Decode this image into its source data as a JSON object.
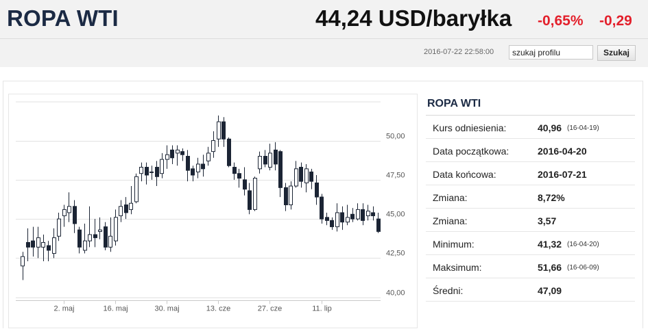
{
  "header": {
    "title": "ROPA WTI",
    "price": "44,24 USD/baryłka",
    "change_pct": "-0,65%",
    "change_abs": "-0,29",
    "timestamp": "2016-07-22 22:58:00",
    "search_value": "szukaj profilu",
    "search_button": "Szukaj"
  },
  "colors": {
    "negative": "#e3202c",
    "up_candle": "#ffffff",
    "down_candle": "#1b2434",
    "title": "#1b2a44"
  },
  "info": {
    "title": "ROPA WTI",
    "rows": [
      {
        "label": "Kurs odniesienia:",
        "value": "40,96",
        "date": "(16-04-19)"
      },
      {
        "label": "Data początkowa:",
        "value": "2016-04-20",
        "date": ""
      },
      {
        "label": "Data końcowa:",
        "value": "2016-07-21",
        "date": ""
      },
      {
        "label": "Zmiana:",
        "value": "8,72%",
        "date": ""
      },
      {
        "label": "Zmiana:",
        "value": "3,57",
        "date": ""
      },
      {
        "label": "Minimum:",
        "value": "41,32",
        "date": "(16-04-20)"
      },
      {
        "label": "Maksimum:",
        "value": "51,66",
        "date": "(16-06-09)"
      },
      {
        "label": "Średni:",
        "value": "47,09",
        "date": ""
      }
    ]
  },
  "chart_data": {
    "type": "candlestick",
    "y_ticks": [
      40,
      42.5,
      45,
      47.5,
      50
    ],
    "y_tick_labels": [
      "40,00",
      "42,50",
      "45,00",
      "47,50",
      "50,00"
    ],
    "ylim": [
      39.9,
      52.6
    ],
    "x_tick_index": [
      8,
      18,
      28,
      38,
      48,
      58
    ],
    "x_tick_labels": [
      "2. maj",
      "16. maj",
      "30. maj",
      "13. cze",
      "27. cze",
      "11. lip"
    ],
    "grid": true,
    "candles": [
      [
        42.0,
        42.6,
        41.1,
        42.9
      ],
      [
        43.5,
        43.2,
        42.3,
        44.4
      ],
      [
        43.6,
        43.2,
        42.6,
        44.5
      ],
      [
        43.2,
        43.8,
        42.5,
        44.5
      ],
      [
        43.2,
        43.5,
        42.3,
        44.0
      ],
      [
        43.3,
        43.0,
        42.3,
        43.6
      ],
      [
        42.8,
        43.8,
        42.5,
        44.4
      ],
      [
        43.9,
        45.0,
        43.6,
        45.4
      ],
      [
        45.2,
        45.6,
        44.5,
        45.9
      ],
      [
        45.4,
        45.8,
        44.8,
        46.7
      ],
      [
        45.8,
        44.7,
        44.1,
        46.2
      ],
      [
        44.3,
        43.2,
        42.8,
        44.5
      ],
      [
        43.0,
        43.6,
        42.8,
        44.7
      ],
      [
        43.6,
        44.0,
        43.2,
        45.8
      ],
      [
        44.0,
        43.8,
        43.2,
        45.0
      ],
      [
        44.2,
        44.3,
        43.7,
        45.1
      ],
      [
        44.5,
        43.2,
        43.0,
        44.8
      ],
      [
        43.2,
        43.9,
        42.9,
        45.1
      ],
      [
        43.6,
        45.1,
        43.3,
        45.6
      ],
      [
        45.2,
        45.8,
        44.8,
        46.2
      ],
      [
        45.9,
        45.4,
        45.0,
        46.4
      ],
      [
        45.6,
        46.0,
        45.3,
        47.1
      ],
      [
        46.1,
        47.7,
        46.0,
        47.9
      ],
      [
        47.9,
        48.3,
        47.4,
        48.6
      ],
      [
        48.3,
        47.8,
        47.2,
        48.6
      ],
      [
        48.0,
        48.0,
        47.5,
        48.4
      ],
      [
        48.3,
        47.7,
        47.1,
        48.7
      ],
      [
        47.9,
        48.8,
        47.6,
        49.2
      ],
      [
        48.8,
        49.1,
        48.2,
        49.7
      ],
      [
        49.4,
        48.9,
        48.5,
        49.7
      ],
      [
        49.2,
        49.4,
        48.4,
        49.7
      ],
      [
        49.3,
        49.1,
        48.7,
        49.5
      ],
      [
        49.0,
        48.1,
        47.4,
        49.4
      ],
      [
        48.2,
        47.8,
        47.4,
        48.4
      ],
      [
        48.0,
        48.5,
        47.6,
        48.9
      ],
      [
        48.5,
        48.2,
        47.7,
        49.1
      ],
      [
        48.7,
        49.2,
        48.4,
        49.6
      ],
      [
        49.3,
        50.0,
        48.9,
        50.6
      ],
      [
        50.1,
        51.2,
        49.6,
        51.6
      ],
      [
        51.2,
        50.1,
        49.6,
        51.5
      ],
      [
        50.1,
        48.4,
        48.3,
        50.2
      ],
      [
        48.3,
        47.9,
        47.5,
        48.6
      ],
      [
        47.9,
        47.6,
        47.0,
        48.2
      ],
      [
        47.5,
        46.9,
        46.5,
        48.3
      ],
      [
        46.8,
        45.6,
        45.3,
        47.3
      ],
      [
        45.6,
        47.6,
        45.5,
        47.7
      ],
      [
        48.2,
        49.0,
        47.9,
        49.3
      ],
      [
        49.0,
        48.5,
        48.3,
        49.4
      ],
      [
        48.3,
        49.2,
        48.1,
        49.8
      ],
      [
        49.4,
        48.5,
        48.1,
        49.9
      ],
      [
        49.3,
        47.0,
        46.4,
        49.4
      ],
      [
        47.0,
        45.9,
        45.5,
        47.3
      ],
      [
        45.9,
        47.1,
        45.6,
        47.4
      ],
      [
        47.1,
        48.2,
        47.0,
        48.7
      ],
      [
        48.3,
        47.4,
        47.0,
        48.6
      ],
      [
        47.3,
        48.2,
        46.7,
        48.5
      ],
      [
        48.0,
        47.4,
        46.9,
        48.2
      ],
      [
        47.3,
        46.4,
        45.9,
        47.8
      ],
      [
        46.4,
        45.0,
        44.7,
        46.6
      ],
      [
        45.1,
        44.9,
        44.6,
        45.4
      ],
      [
        44.9,
        44.5,
        44.3,
        45.1
      ],
      [
        44.5,
        45.4,
        44.2,
        46.0
      ],
      [
        45.4,
        44.8,
        44.3,
        45.8
      ],
      [
        44.8,
        45.1,
        44.6,
        45.9
      ],
      [
        45.3,
        45.0,
        44.8,
        45.7
      ],
      [
        45.0,
        45.6,
        44.9,
        46.0
      ],
      [
        45.6,
        44.9,
        44.6,
        46.0
      ],
      [
        45.2,
        45.5,
        44.9,
        45.9
      ],
      [
        45.4,
        45.2,
        44.9,
        45.8
      ],
      [
        45.0,
        44.2,
        44.1,
        45.4
      ]
    ]
  }
}
